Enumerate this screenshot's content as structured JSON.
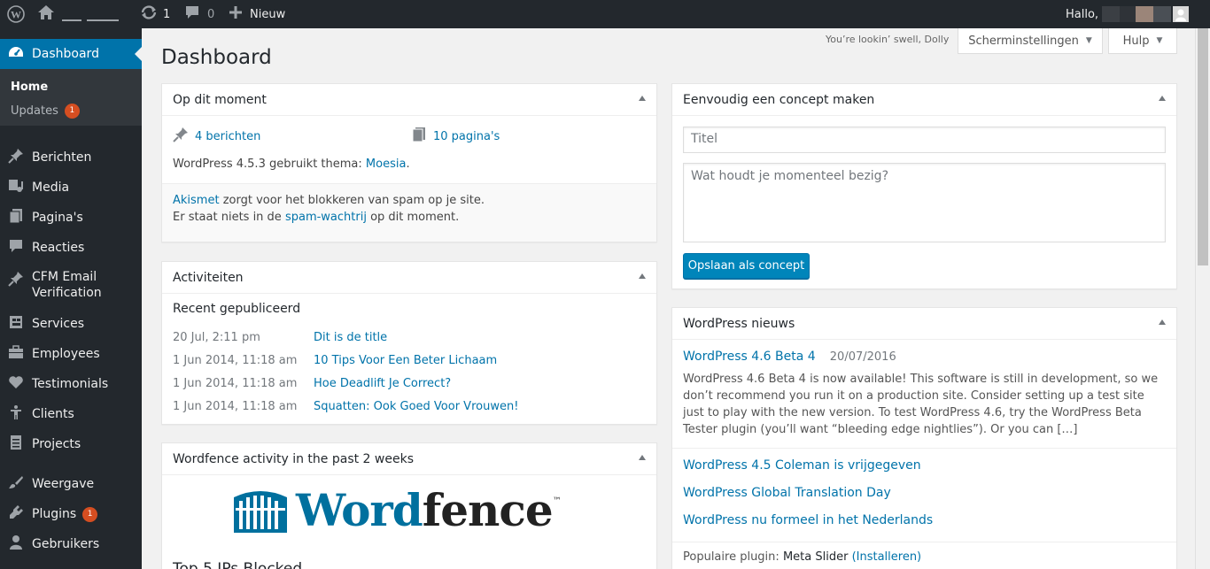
{
  "adminbar": {
    "updates_count": "1",
    "comments_count": "0",
    "new_label": "Nieuw",
    "greeting": "Hallo,"
  },
  "sidebar": {
    "dashboard": "Dashboard",
    "home": "Home",
    "updates": "Updates",
    "updates_badge": "1",
    "items": [
      {
        "label": "Berichten",
        "icon": "pin-icon"
      },
      {
        "label": "Media",
        "icon": "media-icon"
      },
      {
        "label": "Pagina's",
        "icon": "pages-icon"
      },
      {
        "label": "Reacties",
        "icon": "comments-icon"
      },
      {
        "label": "CFM Email Verification",
        "icon": "pin-icon"
      },
      {
        "label": "Services",
        "icon": "services-icon"
      },
      {
        "label": "Employees",
        "icon": "employees-icon"
      },
      {
        "label": "Testimonials",
        "icon": "heart-icon"
      },
      {
        "label": "Clients",
        "icon": "clients-icon"
      },
      {
        "label": "Projects",
        "icon": "projects-icon"
      },
      {
        "label": "Weergave",
        "icon": "appearance-icon"
      },
      {
        "label": "Plugins",
        "icon": "plugins-icon"
      },
      {
        "label": "Gebruikers",
        "icon": "users-icon"
      }
    ],
    "plugins_badge": "1"
  },
  "header": {
    "dolly": "You’re lookin’ swell, Dolly",
    "screen_options": "Scherminstellingen",
    "help": "Hulp",
    "page_title": "Dashboard"
  },
  "at_a_glance": {
    "title": "Op dit moment",
    "posts": "4 berichten",
    "pages": "10 pagina's",
    "theme_text": "WordPress 4.5.3 gebruikt thema:",
    "theme_link": "Moesia",
    "akismet_link": "Akismet",
    "akismet_text": " zorgt voor het blokkeren van spam op je site.",
    "spam_text_before": "Er staat niets in de ",
    "spam_link": "spam-wachtrij",
    "spam_text_after": " op dit moment."
  },
  "activity": {
    "title": "Activiteiten",
    "subtitle": "Recent gepubliceerd",
    "rows": [
      {
        "date": "20 Jul, 2:11 pm",
        "title": "Dit is de title"
      },
      {
        "date": "1 Jun 2014, 11:18 am",
        "title": "10 Tips Voor Een Beter Lichaam"
      },
      {
        "date": "1 Jun 2014, 11:18 am",
        "title": "Hoe Deadlift Je Correct?"
      },
      {
        "date": "1 Jun 2014, 11:18 am",
        "title": "Squatten: Ook Goed Voor Vrouwen!"
      }
    ]
  },
  "wordfence": {
    "title": "Wordfence activity in the past 2 weeks",
    "logo_text_a": "Word",
    "logo_text_b": "fence",
    "logo_tm": "™",
    "partial_heading": "Top 5 IPs Blocked"
  },
  "quick_draft": {
    "title": "Eenvoudig een concept maken",
    "title_placeholder": "Titel",
    "content_placeholder": "Wat houdt je momenteel bezig?",
    "save_label": "Opslaan als concept"
  },
  "news": {
    "title": "WordPress nieuws",
    "lead_title": "WordPress 4.6 Beta 4",
    "lead_date": "20/07/2016",
    "lead_excerpt": "WordPress 4.6 Beta 4 is now available! This software is still in development, so we don’t recommend you run it on a production site. Consider setting up a test site just to play with the new version. To test WordPress 4.6, try the WordPress Beta Tester plugin (you’ll want “bleeding edge nightlies”). Or you can […]",
    "links": [
      "WordPress 4.5 Coleman is vrijgegeven",
      "WordPress Global Translation Day",
      "WordPress nu formeel in het Nederlands"
    ],
    "popular_label": "Populaire plugin:",
    "popular_name": "Meta Slider",
    "popular_install": "(Installeren)"
  }
}
